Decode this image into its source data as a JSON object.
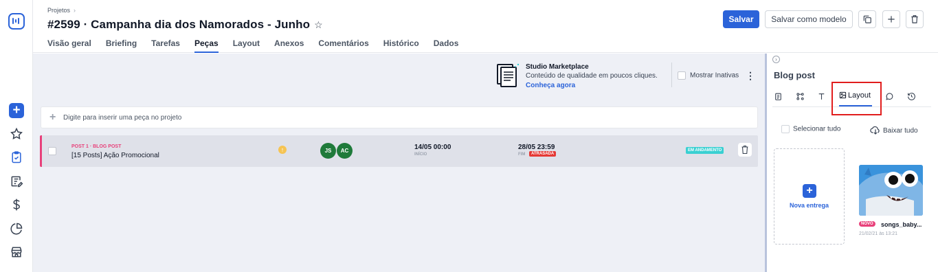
{
  "sidebar": {
    "items": [
      {
        "icon": "star-icon"
      },
      {
        "icon": "clipboard-check-icon"
      },
      {
        "icon": "edit-note-icon"
      },
      {
        "icon": "dollar-icon"
      },
      {
        "icon": "pie-chart-icon"
      },
      {
        "icon": "store-icon"
      }
    ]
  },
  "header": {
    "breadcrumb": "Projetos",
    "title": "#2599 · Campanha dia dos Namorados - Junho",
    "tabs": [
      {
        "label": "Visão geral"
      },
      {
        "label": "Briefing"
      },
      {
        "label": "Tarefas"
      },
      {
        "label": "Peças",
        "active": true
      },
      {
        "label": "Layout"
      },
      {
        "label": "Anexos"
      },
      {
        "label": "Comentários"
      },
      {
        "label": "Histórico"
      },
      {
        "label": "Dados"
      }
    ],
    "save_label": "Salvar",
    "save_model_label": "Salvar como modelo"
  },
  "marketplace": {
    "title": "Studio Marketplace",
    "subtitle": "Conteúdo de qualidade em poucos cliques.",
    "link": "Conheça agora"
  },
  "show_inactive_label": "Mostrar Inativas",
  "new_piece": {
    "placeholder": "Digite para inserir uma peça no projeto"
  },
  "pieces": [
    {
      "kind": "POST 1 · BLOG POST",
      "name": "[15 Posts] Ação Promocional",
      "assignees": [
        "JS",
        "AC"
      ],
      "start_date": "14/05 00:00",
      "start_label": "INÍCIO",
      "end_date": "28/05 23:59",
      "end_label": "FIM",
      "late_label": "ATRASADA",
      "status": "EM ANDAMENTO"
    }
  ],
  "panel": {
    "title": "Blog post",
    "active_tab": "Layout",
    "select_all": "Selecionar tudo",
    "download_all": "Baixar tudo",
    "new_delivery": "Nova entrega",
    "file": {
      "badge": "NOVO",
      "name": "songs_baby...",
      "date": "21/02/21 às 13:21"
    }
  },
  "colors": {
    "primary": "#2b63d9",
    "accent_pink": "#e8407a",
    "status_teal": "#3ad0d2",
    "late_red": "#e53935",
    "avatar_green": "#1f7a3a"
  }
}
